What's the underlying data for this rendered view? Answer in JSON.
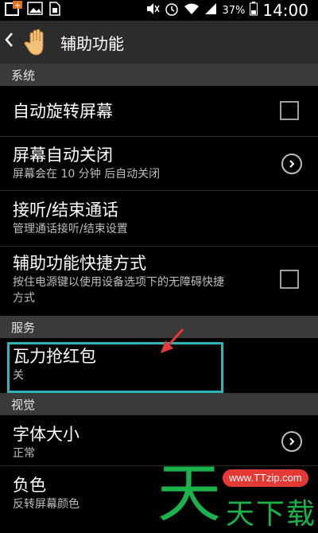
{
  "status_bar": {
    "battery": "37%",
    "time": "14:00"
  },
  "action_bar": {
    "back_glyph": "<",
    "title": "辅助功能"
  },
  "sections": {
    "system": "系统",
    "services": "服务",
    "vision": "视觉"
  },
  "items": {
    "auto_rotate": {
      "title": "自动旋转屏幕"
    },
    "screen_timeout": {
      "title": "屏幕自动关闭",
      "subtitle": "屏幕会在 10 分钟 后自动关闭"
    },
    "answer_end_calls": {
      "title": "接听/结束通话",
      "subtitle": "管理通话接听/结束设置"
    },
    "shortcut": {
      "title": "辅助功能快捷方式",
      "subtitle_line1": "按住电源键以使用设备选项下的无障碍快捷",
      "subtitle_line2": "方式"
    },
    "red_packet": {
      "title": "瓦力抢红包",
      "subtitle": "关"
    },
    "font_size": {
      "title": "字体大小",
      "subtitle": "正常"
    },
    "negative": {
      "title": "负色",
      "subtitle": "反转屏幕颜色"
    }
  },
  "watermark": {
    "url": "www.TTzip.com",
    "big_char": "天",
    "small_text": "天下载"
  },
  "colors": {
    "highlight": "#2fb4b9",
    "arrow": "#e53935",
    "watermark_green": "#1bb24b"
  }
}
